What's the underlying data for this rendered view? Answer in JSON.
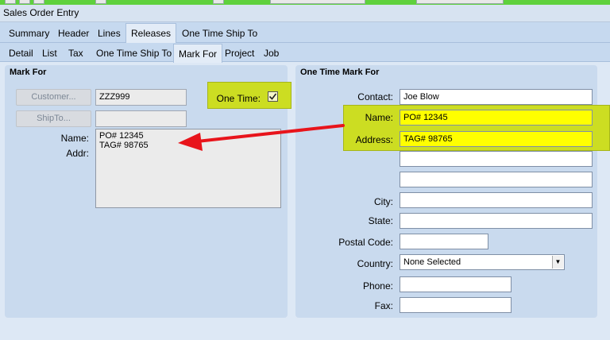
{
  "window": {
    "title": "Sales Order Entry"
  },
  "tabs_primary": [
    "Summary",
    "Header",
    "Lines",
    "Releases",
    "One Time Ship To"
  ],
  "tabs_secondary": [
    "Detail",
    "List",
    "Tax",
    "One Time Ship To",
    "Mark For",
    "Project",
    "Job"
  ],
  "mark_for": {
    "title": "Mark For",
    "customer_button": "Customer...",
    "customer_value": "ZZZ999",
    "shipto_button": "ShipTo...",
    "shipto_value": "",
    "one_time_label": "One Time:",
    "one_time_checked": true,
    "name_label": "Name:",
    "addr_label": "Addr:",
    "addr_line1": "PO# 12345",
    "addr_line2": "TAG# 98765"
  },
  "one_time_mark_for": {
    "title": "One Time Mark For",
    "contact_label": "Contact:",
    "contact_value": "Joe Blow",
    "name_label": "Name:",
    "name_value": "PO# 12345",
    "address_label": "Address:",
    "address_value": "TAG# 98765",
    "address2_value": "",
    "address3_value": "",
    "city_label": "City:",
    "city_value": "",
    "state_label": "State:",
    "state_value": "",
    "postal_label": "Postal Code:",
    "postal_value": "",
    "country_label": "Country:",
    "country_value": "None Selected",
    "phone_label": "Phone:",
    "phone_value": "",
    "fax_label": "Fax:",
    "fax_value": ""
  },
  "colors": {
    "highlight": "#ccdd22",
    "field_highlight": "#ffff00",
    "arrow": "#e8141b",
    "toolbar": "#5fd13d"
  }
}
